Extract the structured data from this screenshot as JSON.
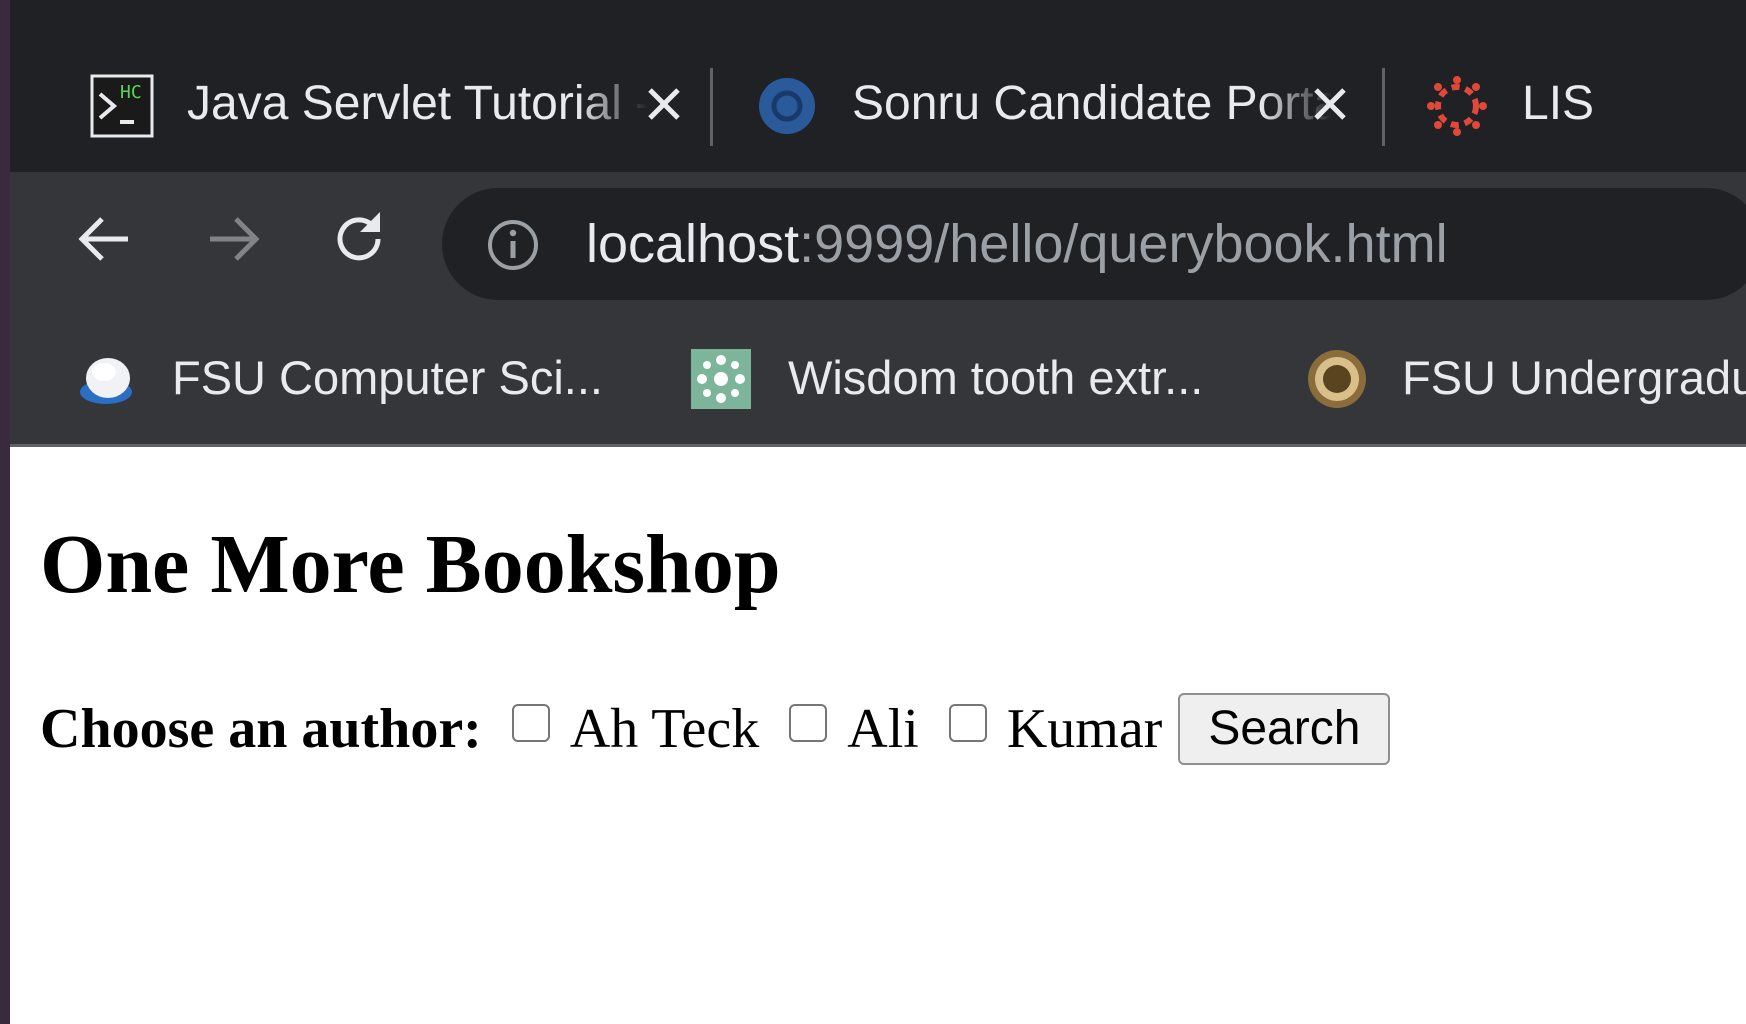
{
  "tabs": [
    {
      "title": "Java Servlet Tutorial - ",
      "favicon": "terminal-icon"
    },
    {
      "title": "Sonru Candidate Portal",
      "favicon": "sonru-logo-icon"
    },
    {
      "title": "LIS",
      "favicon": "canvas-logo-icon"
    }
  ],
  "toolbar": {
    "url_host": "localhost",
    "url_rest": ":9999/hello/querybook.html"
  },
  "bookmarks": [
    {
      "label": "FSU Computer Sci...",
      "icon": "fsu-cs-icon"
    },
    {
      "label": "Wisdom tooth extr...",
      "icon": "wisdom-tooth-icon"
    },
    {
      "label": "FSU Undergradu",
      "icon": "fsu-seal-icon"
    }
  ],
  "page": {
    "heading": "One More Bookshop",
    "form_label": "Choose an author:",
    "authors": [
      "Ah Teck",
      "Ali",
      "Kumar"
    ],
    "search_button": "Search"
  },
  "colors": {
    "tab_strip": "#202124",
    "toolbar": "#35363a",
    "text_light": "#e8eaed",
    "url_dim": "#9aa0a6"
  }
}
